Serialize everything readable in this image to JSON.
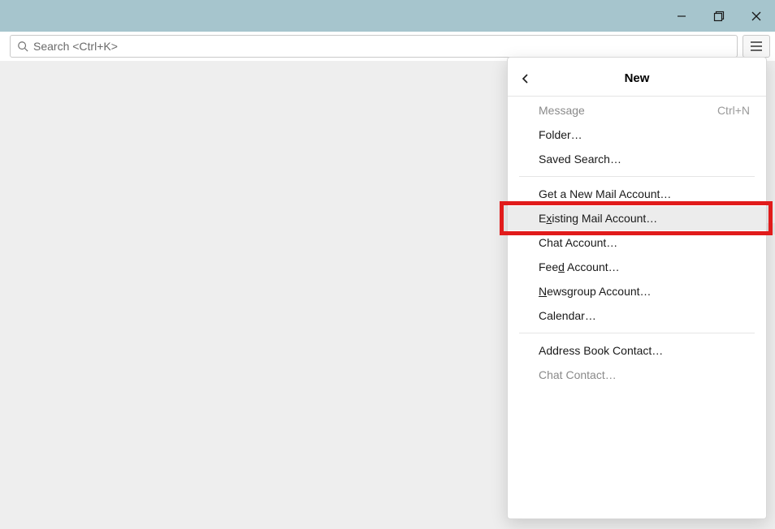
{
  "search": {
    "placeholder": "Search <Ctrl+K>"
  },
  "menu": {
    "title": "New",
    "items": {
      "message": {
        "label": "Message",
        "shortcut": "Ctrl+N"
      },
      "folder": {
        "label": "Folder…"
      },
      "saved_search": {
        "label": "Saved Search…"
      },
      "get_new_mail": {
        "label": "Get a New Mail Account…"
      },
      "existing_mail_pre": "E",
      "existing_mail_u": "x",
      "existing_mail_post": "isting Mail Account…",
      "chat_account": {
        "label": "Chat Account…"
      },
      "feed_pre": "Fee",
      "feed_u": "d",
      "feed_post": " Account…",
      "newsgroup_u": "N",
      "newsgroup_post": "ewsgroup Account…",
      "calendar": {
        "label": "Calendar…"
      },
      "address_book": {
        "label": "Address Book Contact…"
      },
      "chat_contact": {
        "label": "Chat Contact…"
      }
    }
  }
}
